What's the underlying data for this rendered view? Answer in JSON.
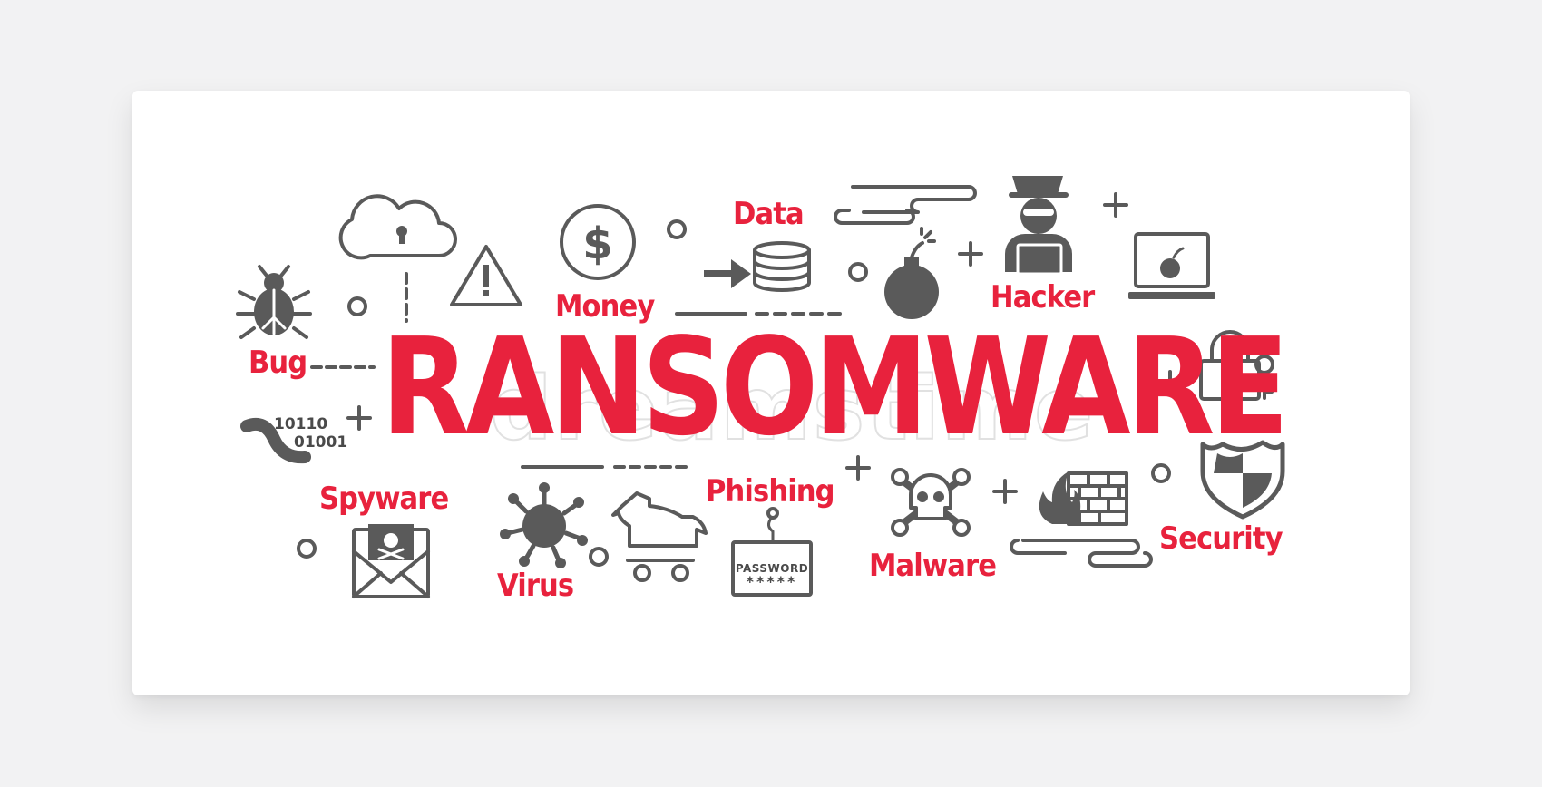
{
  "headline": "RANSOMWARE",
  "watermark": "dreamstime",
  "labels": {
    "data": "Data",
    "money": "Money",
    "hacker": "Hacker",
    "bug": "Bug",
    "spyware": "Spyware",
    "virus": "Virus",
    "phishing": "Phishing",
    "malware": "Malware",
    "security": "Security"
  },
  "binary": {
    "line1": "10110",
    "line2": "01001"
  },
  "password": {
    "label": "PASSWORD",
    "mask": "*****"
  },
  "colors": {
    "accent": "#e8223d",
    "icon": "#5a5a5a",
    "background": "#f2f2f3",
    "card": "#ffffff"
  },
  "icons": [
    "cloud-lock-icon",
    "warning-icon",
    "dollar-coin-icon",
    "database-arrow-icon",
    "bomb-icon",
    "hacker-icon",
    "laptop-bomb-icon",
    "bug-icon",
    "padlock-icon",
    "key-icon",
    "worm-icon",
    "shield-icon",
    "spyware-envelope-icon",
    "virus-icon",
    "trojan-horse-icon",
    "password-hook-icon",
    "skull-crossbones-icon",
    "firewall-icon",
    "cloud-streak-icon",
    "plus-icon",
    "circle-icon"
  ]
}
